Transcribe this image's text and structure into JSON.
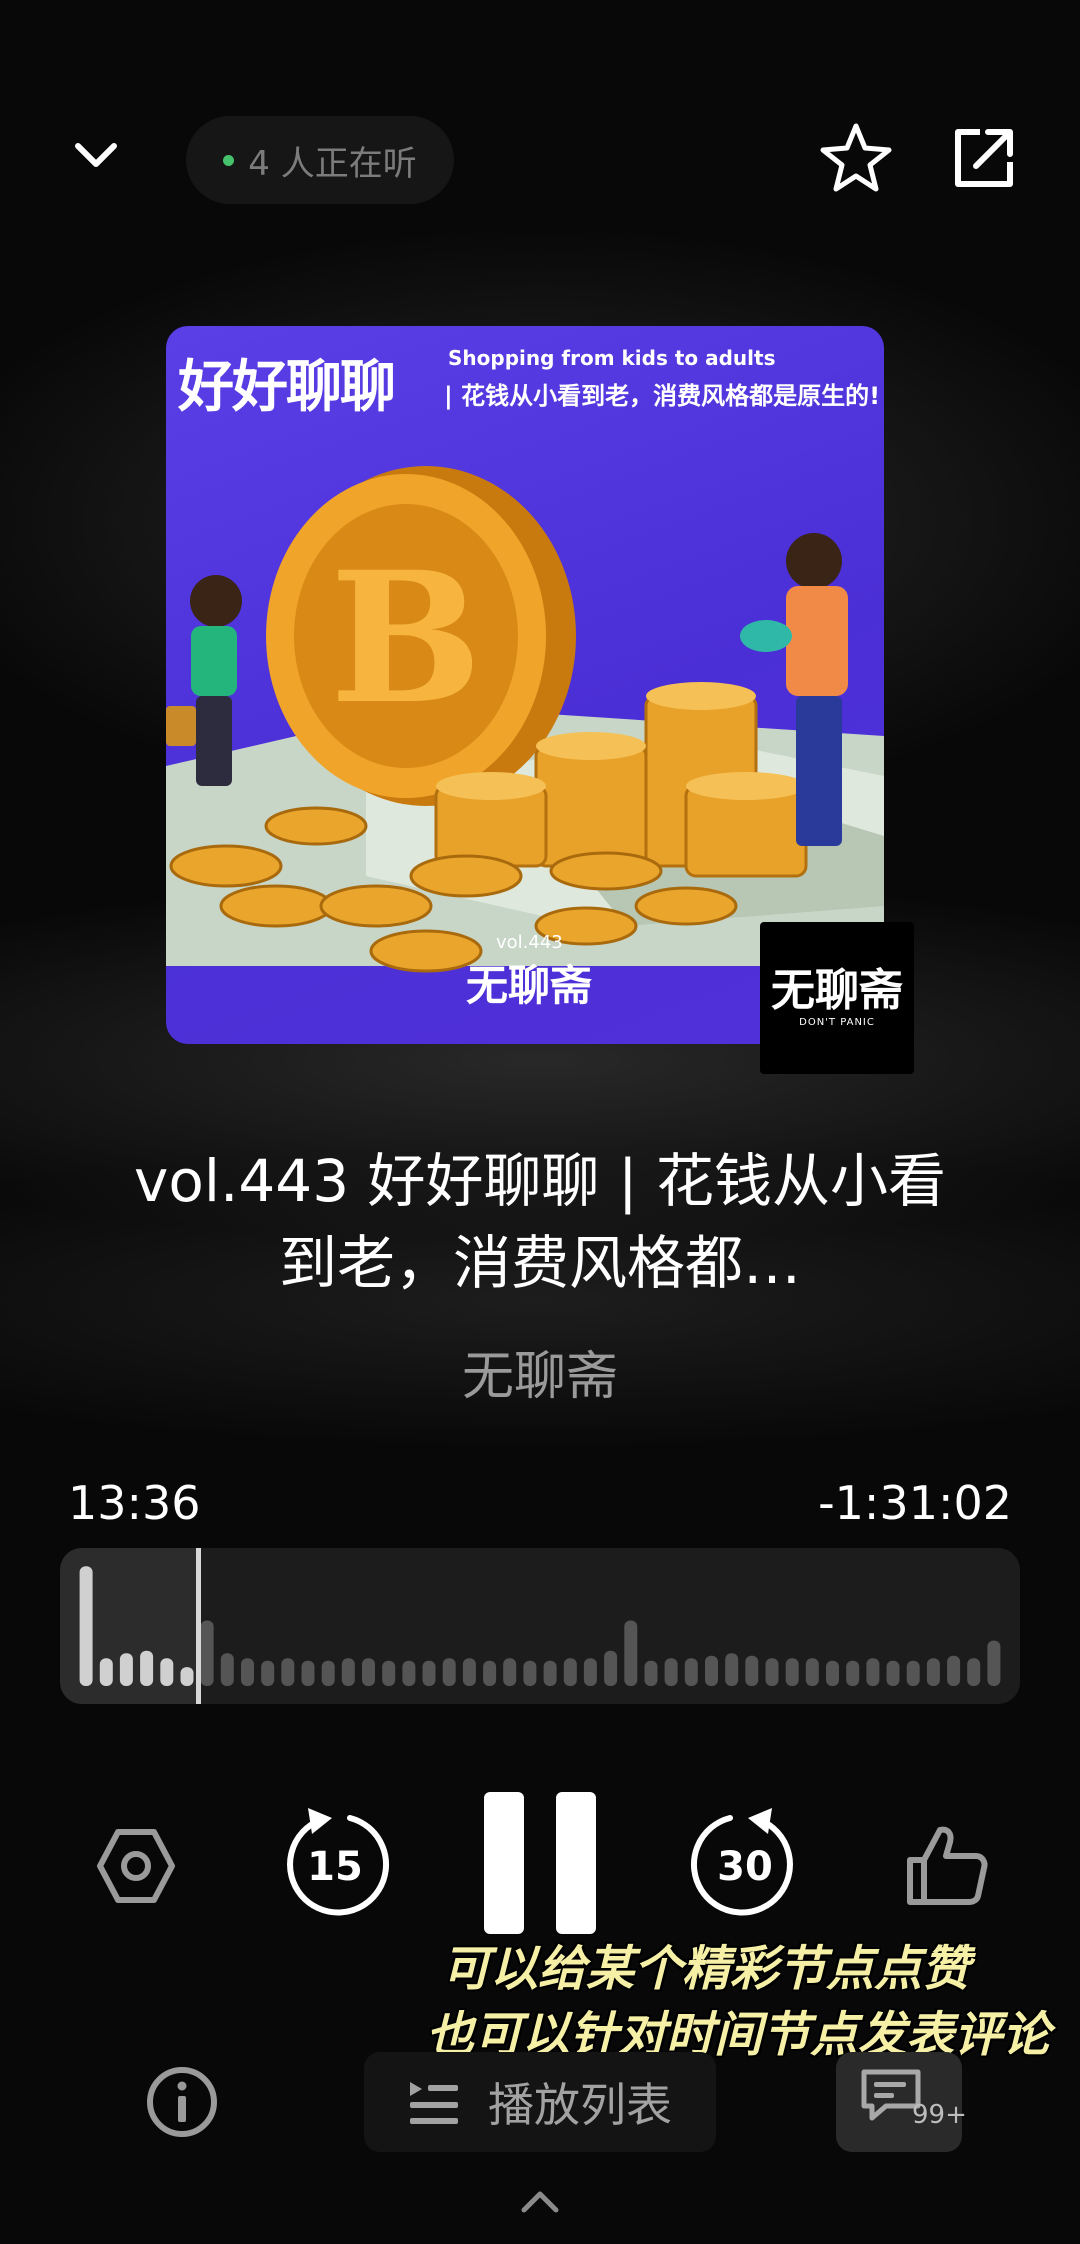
{
  "header": {
    "listeners_text": "4 人正在听"
  },
  "cover": {
    "title": "好好聊聊",
    "subtitle_en": "Shopping from kids to adults",
    "subtitle_cn": "| 花钱从小看到老，消费风格都是原生的!",
    "vol": "vol.443",
    "logo": "无聊斋",
    "logo_sub": "DON'T PANIC"
  },
  "badge": {
    "logo": "无聊斋",
    "sub": "DON'T PANIC"
  },
  "episode": {
    "title": "vol.443 好好聊聊 | 花钱从小看到老，消费风格都…",
    "podcast": "无聊斋"
  },
  "playback": {
    "elapsed": "13:36",
    "remaining": "-1:31:02",
    "progress": 0.1
  },
  "controls": {
    "rewind_seconds": "15",
    "forward_seconds": "30"
  },
  "caption": {
    "line1": "可以给某个精彩节点点赞",
    "line2": "也可以针对时间节点发表评论"
  },
  "bottom": {
    "playlist_label": "播放列表",
    "comments_count": "99+"
  },
  "waveform": {
    "levels": [
      0.95,
      0.22,
      0.26,
      0.28,
      0.22,
      0.15,
      0.52,
      0.26,
      0.22,
      0.2,
      0.22,
      0.2,
      0.2,
      0.22,
      0.22,
      0.2,
      0.2,
      0.2,
      0.22,
      0.22,
      0.2,
      0.22,
      0.2,
      0.2,
      0.22,
      0.22,
      0.28,
      0.52,
      0.2,
      0.22,
      0.22,
      0.24,
      0.26,
      0.24,
      0.22,
      0.22,
      0.22,
      0.2,
      0.2,
      0.22,
      0.2,
      0.2,
      0.22,
      0.24,
      0.22,
      0.36
    ]
  }
}
